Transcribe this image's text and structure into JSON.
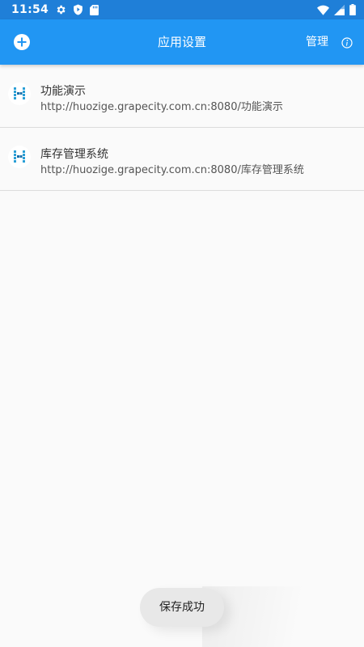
{
  "status_bar": {
    "time": "11:54",
    "icons_left": [
      "settings-gear-icon",
      "shield-play-icon",
      "sd-card-icon"
    ],
    "icons_right": [
      "wifi-icon",
      "cell-signal-icon",
      "battery-icon"
    ]
  },
  "app_bar": {
    "title": "应用设置",
    "manage_label": "管理",
    "add_icon": "plus-circle-icon",
    "info_icon": "info-icon"
  },
  "apps": [
    {
      "name": "功能演示",
      "url": "http://huozige.grapecity.com.cn:8080/功能演示",
      "logo_icon": "huozige-logo-icon"
    },
    {
      "name": "库存管理系统",
      "url": "http://huozige.grapecity.com.cn:8080/库存管理系统",
      "logo_icon": "huozige-logo-icon"
    }
  ],
  "toast": {
    "message": "保存成功"
  },
  "colors": {
    "status_bar": "#1f7fd8",
    "app_bar": "#2196f3",
    "background": "#fafafa",
    "logo_accent": "#2a9fd6"
  }
}
